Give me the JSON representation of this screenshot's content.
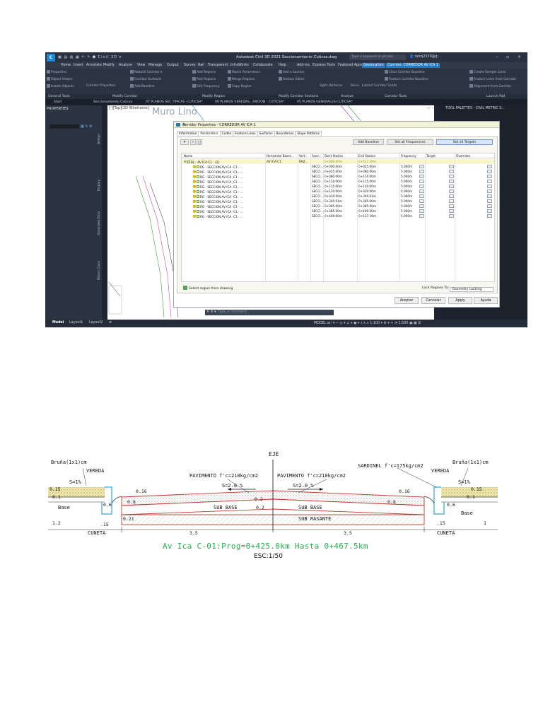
{
  "window": {
    "app_title": "Autodesk Civil 3D 2021   Seccionamiento Cuticsa.dwg",
    "workspace": "Civil 3D",
    "search_placeholder": "Type a keyword or phrase",
    "user": "raicq2559@g..."
  },
  "ribbon_tabs": [
    "Home",
    "Insert",
    "Annotate",
    "Modify",
    "Analyze",
    "View",
    "Manage",
    "Output",
    "Survey",
    "Rail",
    "Transparent",
    "InfraWorks",
    "Collaborate",
    "Help",
    "Add-ins",
    "Express Tools",
    "Featured Apps",
    "Geolocation",
    "Corridor: CORREDOR AV ICA 1"
  ],
  "ribbon_items": {
    "general": [
      "Properties",
      "Object Viewer",
      "Isolate Objects"
    ],
    "modify_corridor": [
      "Rebuild Corridor",
      "Corridor Surfaces",
      "Add Baseline",
      "Corridor Properties",
      "Edit Baseline"
    ],
    "modify_region": [
      "Add Regions",
      "Add Regions",
      "Edit Frequency",
      "Match Parameters",
      "Merge Regions",
      "Copy Region"
    ],
    "sections": [
      "Add a Section",
      "Section Editor",
      "Sight Distance",
      "Drive"
    ],
    "corridor_tools": [
      "Clear Corridor Baseline",
      "Feature Corridor Baseline",
      "Extract Corridor Solids"
    ],
    "launch": [
      "Create Sample Lines",
      "Feature Lines from Corridor",
      "Alignment from Corridor"
    ]
  },
  "panel_labels": [
    "General Tools",
    "Modify Corridor",
    "Modify Region",
    "Modify Corridor Sections",
    "Analyze",
    "Corridor Tools",
    "Launch Pad"
  ],
  "doc_tabs": [
    "Start",
    "Seccionamiento Cuticsa",
    "07 PLANOS SEC TIPICAS -CUTICSA*",
    "09 PLANOS VEREDAS...ENCION - CUTICSA*",
    "05 PLANOS GENERALES-CUTICSA*"
  ],
  "left_panel": {
    "title": "PROPERTIES",
    "side_tabs": [
      "Design",
      "Display",
      "Extended Data",
      "Object Class"
    ]
  },
  "viewport": {
    "label": "[-][Top][2D Wireframe]",
    "watermark": "Muro  Lino"
  },
  "right_panel": {
    "title": "TOOL PALETTES - CIVIL METRIC S..."
  },
  "command_line": {
    "placeholder": "Type a command"
  },
  "status_bar": {
    "tabs": [
      "Model",
      "Layout1",
      "Layout2"
    ],
    "right": "MODEL",
    "scale": "1:500",
    "units": "1:100"
  },
  "dialog": {
    "title": "Corridor Properties - CORREDOR AV ICA 1",
    "tabs": [
      "Information",
      "Parameters",
      "Codes",
      "Feature Lines",
      "Surfaces",
      "Boundaries",
      "Slope Patterns"
    ],
    "buttons": [
      "Add Baseline",
      "Set all Frequencies",
      "Set all Targets"
    ],
    "columns": [
      "Name",
      "Horizontal Basel...",
      "Vert...",
      "Asse...",
      "Start Station",
      "End Station",
      "Frequency",
      "Target",
      "Overrides"
    ],
    "baseline_row": {
      "name": "BL - AV ICA-C1 - (2)",
      "horizontal": "AV ICA-C1",
      "vertical": "RAZ...",
      "start": "0+000.00m",
      "end": "0+517.39m"
    },
    "rows": [
      {
        "name": "RG - SECCION AV ICA -C1 - ...",
        "assembly": "SECCI...",
        "start": "0+000.00m",
        "end": "0+025.00m",
        "frequency": "5.000m"
      },
      {
        "name": "RG - SECCION AV ICA -C1 - ...",
        "assembly": "SECCI...",
        "start": "0+025.00m",
        "end": "0+080.00m",
        "frequency": "5.000m"
      },
      {
        "name": "RG - SECCION AV ICA -C1 - ...",
        "assembly": "SECCI...",
        "start": "0+080.00m",
        "end": "0+110.00m",
        "frequency": "5.000m"
      },
      {
        "name": "RG - SECCION AV ICA -C1 - ...",
        "assembly": "SECCI...",
        "start": "0+110.00m",
        "end": "0+115.00m",
        "frequency": "5.000m"
      },
      {
        "name": "RG - SECCION AV ICA -C1 - ...",
        "assembly": "SECCI...",
        "start": "0+115.00m",
        "end": "0+120.00m",
        "frequency": "5.000m"
      },
      {
        "name": "RG - SECCION AV ICA -C1 - ...",
        "assembly": "SECCI...",
        "start": "0+120.00m",
        "end": "0+330.00m",
        "frequency": "5.000m"
      },
      {
        "name": "RG - SECCION AV ICA -C1 - ...",
        "assembly": "SECCI...",
        "start": "0+330.00m",
        "end": "0+340.01m",
        "frequency": "5.000m"
      },
      {
        "name": "RG - SECCION AV ICA -C1 - ...",
        "assembly": "SECCI...",
        "start": "0+340.01m",
        "end": "0+365.00m",
        "frequency": "5.000m"
      },
      {
        "name": "RG - SECCION AV ICA -C1 - ...",
        "assembly": "SECCI...",
        "start": "0+365.00m",
        "end": "0+385.00m",
        "frequency": "5.000m"
      },
      {
        "name": "RG - SECCION AV ICA -C1 - ...",
        "assembly": "SECCI...",
        "start": "0+385.00m",
        "end": "0+400.00m",
        "frequency": "5.000m"
      },
      {
        "name": "RG - SECCION AV ICA -C1 - ...",
        "assembly": "SECCI...",
        "start": "0+400.00m",
        "end": "0+517.39m",
        "frequency": "5.000m"
      }
    ],
    "select_region_label": "Select region from drawing",
    "lock_regions_label": "Lock Regions To:",
    "lock_regions_value": "Geometry Locking",
    "footer_buttons": [
      "Aceptar",
      "Cancelar",
      "Apply",
      "Ayuda"
    ]
  },
  "cad_section": {
    "labels": {
      "eje": "EJE",
      "bruna_left": "Bruña(1x1)cm",
      "bruna_right": "Bruña(1x1)cm",
      "vereda_left": "VEREDA",
      "vereda_right": "VEREDA",
      "s1_left": "S=1%",
      "s1_right": "S=1%",
      "pav_left": "PAVIMENTO f'c=210kg/cm2",
      "pav_right": "PAVIMENTO f'c=210kg/cm2",
      "sardinel": "SARDINEL f'c=175kg/cm2",
      "s2_left": "S=2.0 %",
      "s2_right": "S=2.0 %",
      "sub_base_left": "SUB BASE",
      "sub_base_right": "SUB BASE",
      "sub_rasante": "SUB RASANTE",
      "base_left": "Base",
      "base_right": "Base",
      "cuneta_left": "CUNETA",
      "cuneta_right": "CUNETA",
      "d015_left": "0.15",
      "d015_right": "0.15",
      "d016_left": "0.16",
      "d016_right": "0.16",
      "d01_left": "0.1",
      "d01_right": "0.1",
      "d06_left": "0.6",
      "d06_right": "0.6",
      "d08_left": "0.8",
      "d08_right": "0.8",
      "d02_center": "0.2",
      "d02_top": "0.2",
      "d021": "0.21",
      "d12": "1.2",
      "d1": "1",
      "d15_left": ".15",
      "d15_right": ".15",
      "d35_left": "3.5",
      "d35_right": "3.5"
    },
    "title": "Av Ica C-01:Prog=0+425.0km Hasta 0+467.5km",
    "scale": "ESC:1/50"
  },
  "colors": {
    "title_green": "#22b24c",
    "pavement_red": "#c0392b",
    "curb_cyan": "#25a9d6",
    "sidewalk_yellow": "#f3e9a6",
    "accent_blue": "#1f7ac4"
  }
}
